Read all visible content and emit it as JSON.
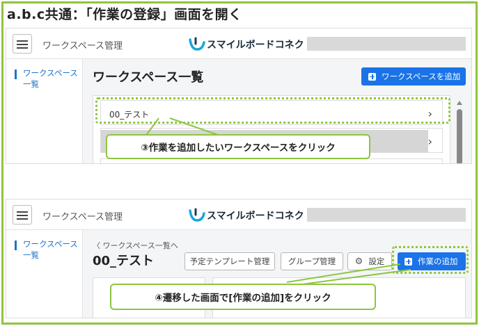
{
  "heading": "a.b.c共通：「作業の登録」画面を開く",
  "app": {
    "title": "ワークスペース管理",
    "logo_text": "スマイルボードコネクト"
  },
  "sidebar": {
    "item": "ワークスペース一覧"
  },
  "screen1": {
    "title": "ワークスペース一覧",
    "add_button": "ワークスペースを追加",
    "rows": [
      "00_テスト"
    ],
    "chevron": "›"
  },
  "screen2": {
    "breadcrumb": "〈 ワークスペース一覧へ",
    "title": "00_テスト",
    "buttons": {
      "template": "予定テンプレート管理",
      "group": "グループ管理",
      "settings": "設定",
      "add_task": "作業の追加"
    }
  },
  "callouts": {
    "step3": "③作業を追加したいワークスペースをクリック",
    "step4": "④遷移した画面で[作業の追加]をクリック"
  },
  "colors": {
    "accent": "#8cc63f",
    "primary": "#1a73e8",
    "link": "#1a73c7"
  }
}
